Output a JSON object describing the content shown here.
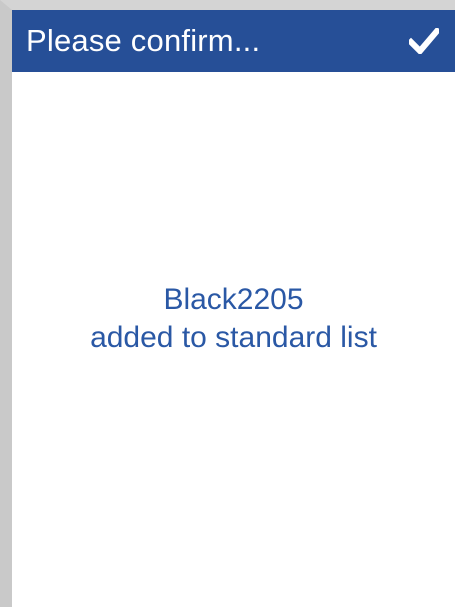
{
  "dialog": {
    "title": "Please confirm...",
    "confirm_icon": "checkmark-icon",
    "message_line1": "Black2205",
    "message_line2": "added to standard list"
  },
  "colors": {
    "title_bar": "#264f97",
    "title_text": "#ffffff",
    "message_text": "#2a58a5",
    "background": "#ffffff"
  }
}
